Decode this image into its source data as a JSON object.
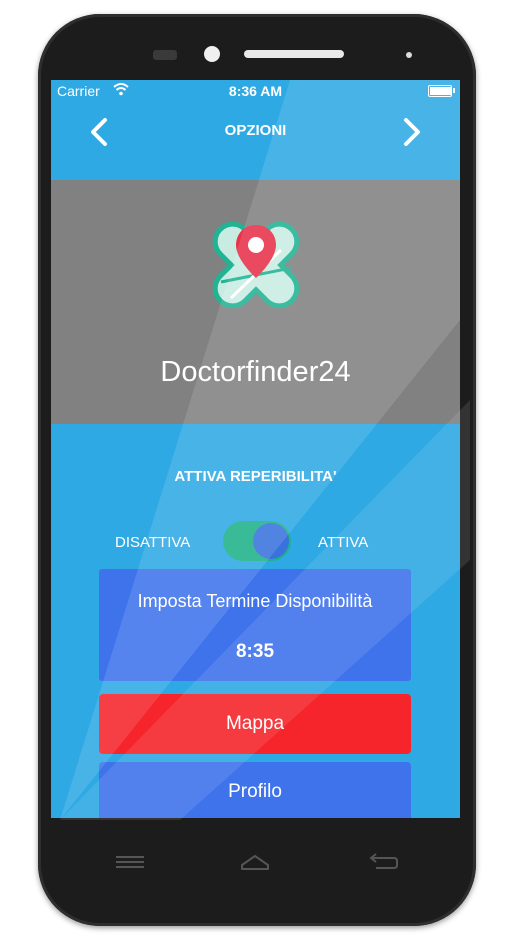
{
  "status_bar": {
    "carrier": "Carrier",
    "time": "8:36 AM",
    "wifi_icon": "wifi-icon",
    "battery_icon": "battery-icon",
    "battery_level": 1.0
  },
  "nav": {
    "title": "OPZIONI",
    "back_icon": "chevron-left-icon",
    "forward_icon": "chevron-right-icon"
  },
  "header": {
    "logo_icon": "map-pin-cross-logo",
    "app_name": "Doctorfinder24"
  },
  "availability": {
    "title": "ATTIVA REPERIBILITA'",
    "label_off": "DISATTIVA",
    "label_on": "ATTIVA",
    "toggle_on": true
  },
  "end_time_card": {
    "title": "Imposta Termine Disponibilità",
    "time": "8:35"
  },
  "buttons": {
    "map": "Mappa",
    "profile": "Profilo"
  },
  "hardware_buttons": [
    "menu-icon",
    "home-icon",
    "back-arrow-icon"
  ],
  "colors": {
    "screen_bg": "#2fa9e4",
    "header_bg": "#818181",
    "card_blue": "#3f73ec",
    "map_red": "#f5252b",
    "toggle_green": "#1eb28a"
  }
}
